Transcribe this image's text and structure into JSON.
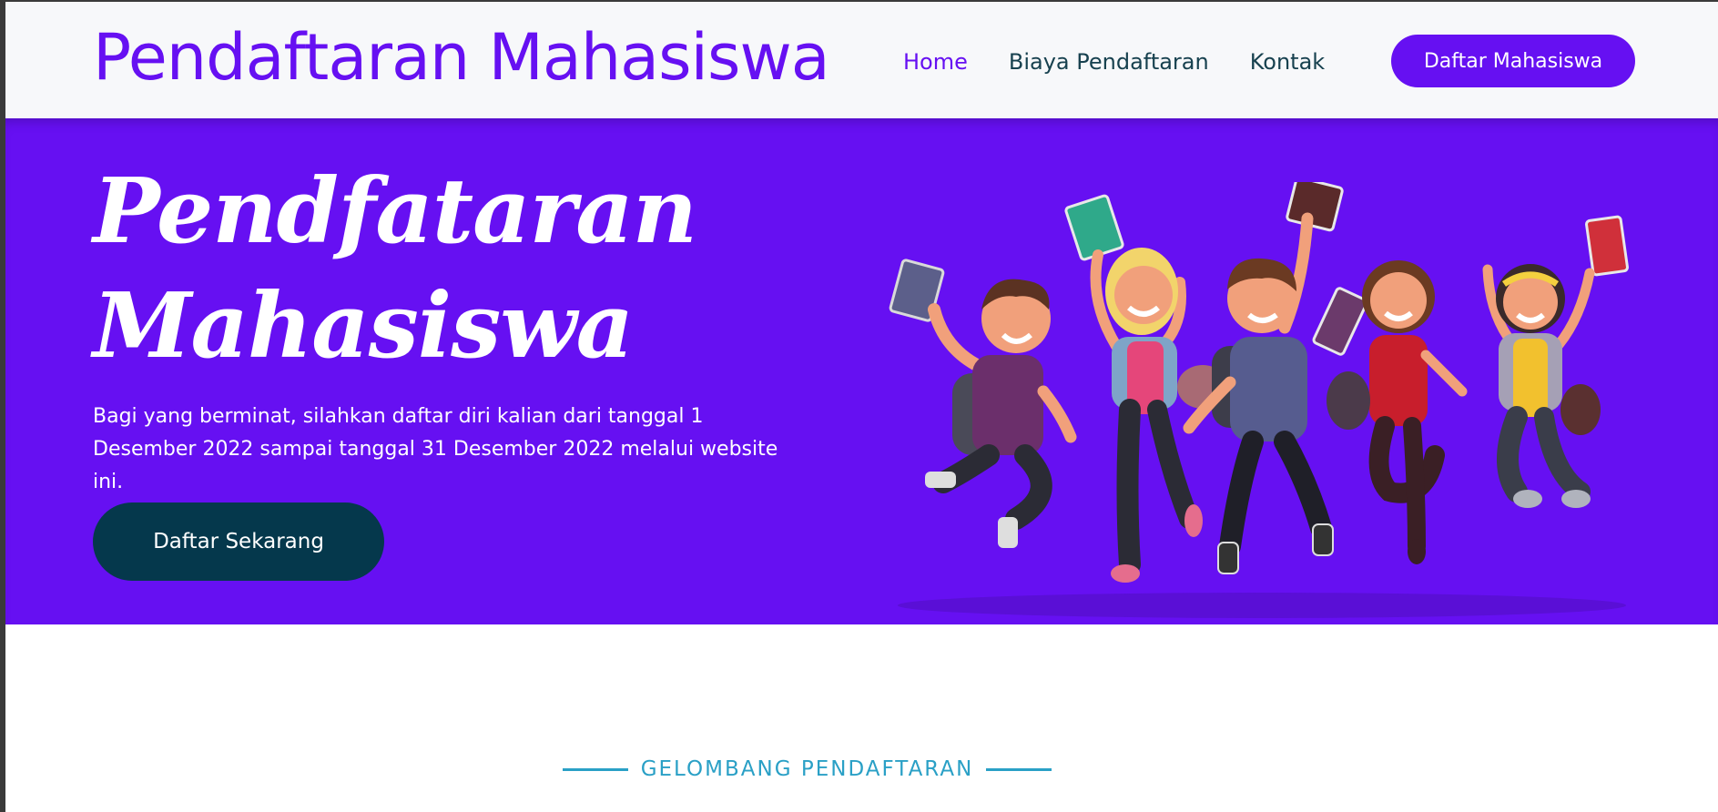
{
  "navbar": {
    "brand": "Pendaftaran Mahasiswa",
    "links": [
      {
        "label": "Home",
        "active": true
      },
      {
        "label": "Biaya Pendaftaran",
        "active": false
      },
      {
        "label": "Kontak",
        "active": false
      }
    ],
    "cta_label": "Daftar Mahasiswa"
  },
  "hero": {
    "title_line1": "Pendfataran",
    "title_line2": "Mahasiswa",
    "text": "Bagi yang berminat, silahkan daftar diri kalian dari tanggal 1 Desember 2022 sampai tanggal 31 Desember 2022 melalui website ini.",
    "button_label": "Daftar Sekarang",
    "illustration": "jumping-students-illustration"
  },
  "section": {
    "label": "GELOMBANG PENDAFTARAN"
  },
  "colors": {
    "primary": "#6610f2",
    "dark": "#05384c",
    "accent": "#2aa0c6",
    "navbar_bg": "#f7f8fa"
  }
}
